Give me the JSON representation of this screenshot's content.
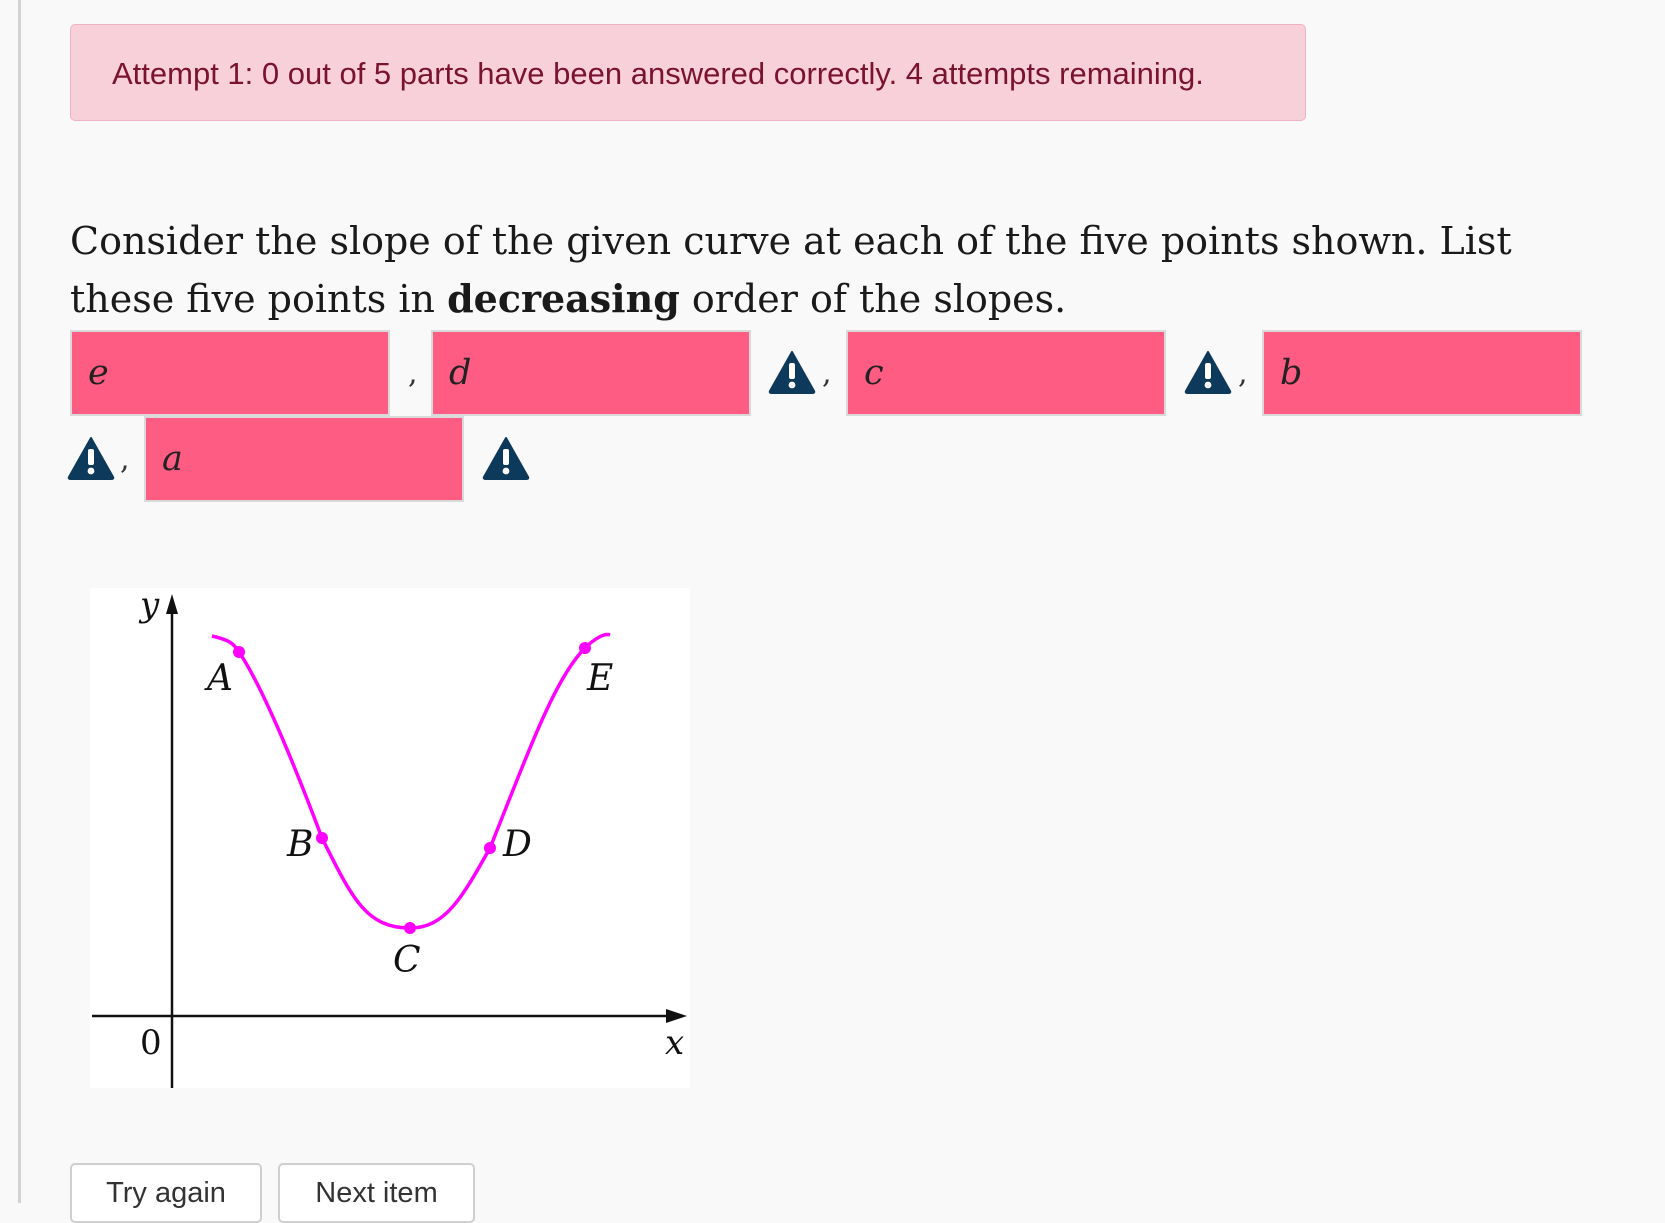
{
  "alert": {
    "text": "Attempt 1: 0 out of 5 parts have been answered correctly. 4 attempts remaining."
  },
  "question": {
    "text_before": "Consider the slope of the given curve at each of the five points shown. List these five points in ",
    "emphasis": "decreasing",
    "text_after": " order of the slopes."
  },
  "answers": {
    "separator": ",",
    "values": [
      "e",
      "d",
      "c",
      "b",
      "a"
    ]
  },
  "graph": {
    "y_axis_label": "y",
    "x_axis_label": "x",
    "origin_label": "0",
    "point_labels": [
      "A",
      "B",
      "C",
      "D",
      "E"
    ],
    "curve_color": "#ff00ff"
  },
  "buttons": {
    "try_again": "Try again",
    "next_item": "Next item"
  },
  "colors": {
    "alert_bg": "#f7d0da",
    "alert_text": "#7b1230",
    "incorrect_field": "#ff5c84",
    "warning_icon": "#0d3a5a"
  }
}
